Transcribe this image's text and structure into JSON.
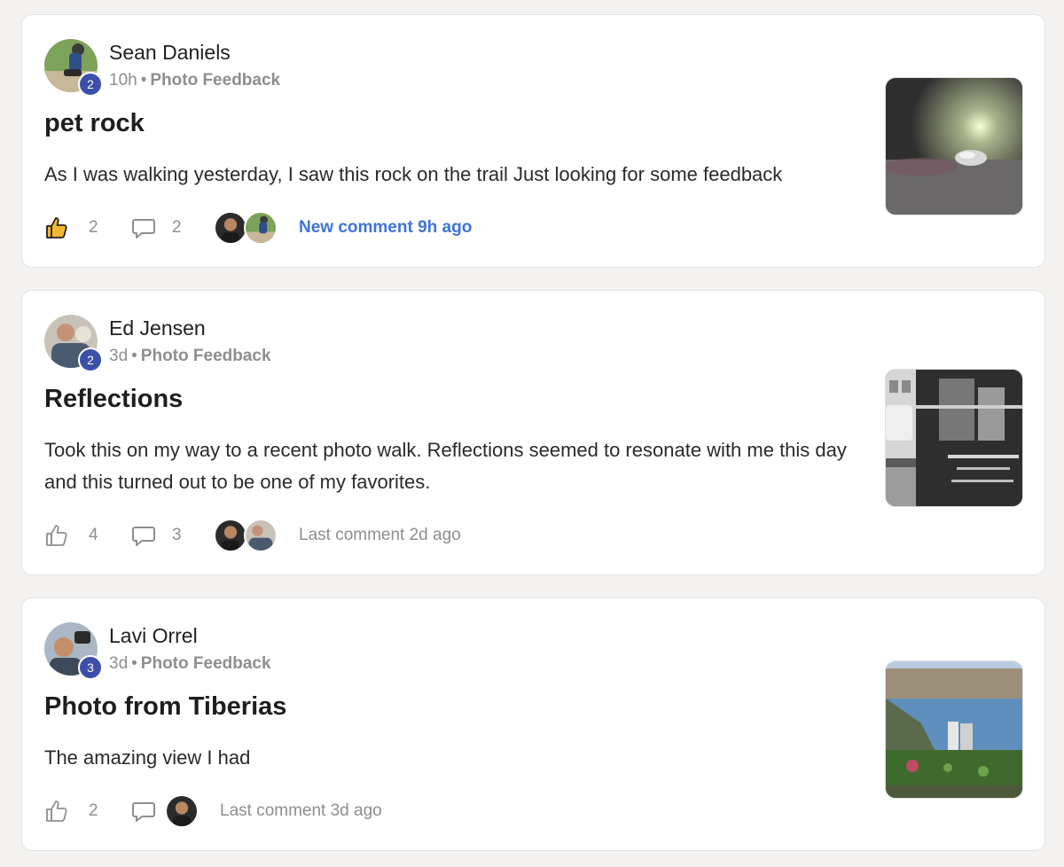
{
  "posts": [
    {
      "author": "Sean Daniels",
      "level": "2",
      "time": "10h",
      "separator": "•",
      "category": "Photo Feedback",
      "title": "pet rock",
      "body": "As I was walking yesterday, I saw this rock on the trail Just looking for some feedback",
      "likes": "2",
      "liked": true,
      "comments": "2",
      "last_comment": "New comment 9h ago",
      "last_comment_new": true
    },
    {
      "author": "Ed Jensen",
      "level": "2",
      "time": "3d",
      "separator": "•",
      "category": "Photo Feedback",
      "title": "Reflections",
      "body": "Took this on my way to a recent photo walk. Reflections seemed to resonate with me this day and this turned out to be one of my favorites.",
      "likes": "4",
      "liked": false,
      "comments": "3",
      "last_comment": "Last comment 2d ago",
      "last_comment_new": false
    },
    {
      "author": "Lavi Orrel",
      "level": "3",
      "time": "3d",
      "separator": "•",
      "category": "Photo Feedback",
      "title": "Photo from Tiberias",
      "body": "The amazing view I had",
      "likes": "2",
      "liked": false,
      "comments": "1",
      "last_comment": "Last comment 3d ago",
      "last_comment_new": false
    }
  ],
  "icons": {
    "like": "thumbs-up-icon",
    "comment": "speech-bubble-icon"
  },
  "colors": {
    "level_badge": "#3c4fa8",
    "new_comment": "#3d74d9",
    "liked": "#f2b632",
    "muted": "#8e8e8e"
  }
}
